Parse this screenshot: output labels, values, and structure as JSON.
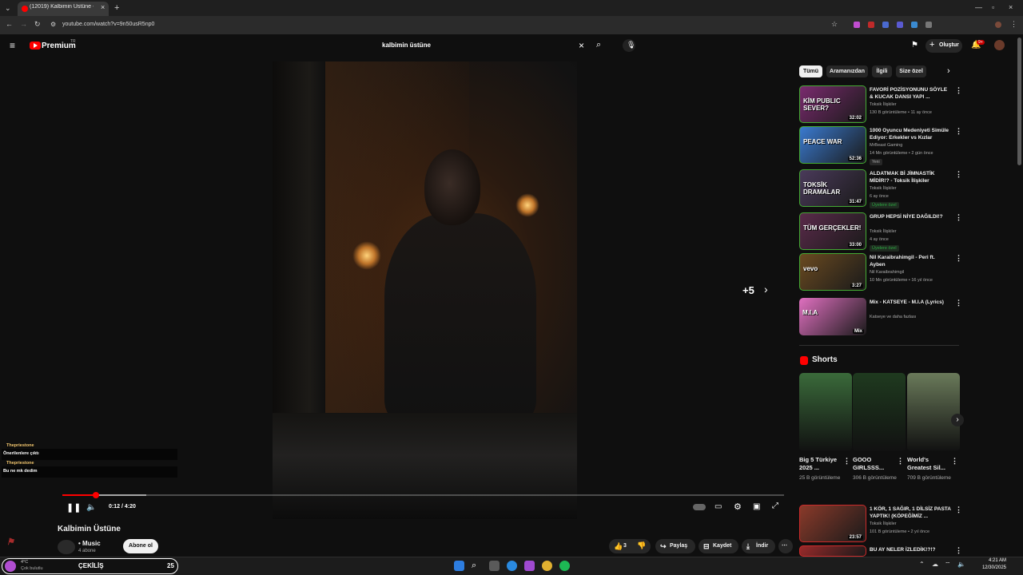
{
  "browser": {
    "tab_title": "(12019) Kalbimin Üstüne -",
    "url": "youtube.com/watch?v=9n50usR5np0"
  },
  "header": {
    "logo_text": "Premium",
    "region": "TR",
    "search_value": "kalbimin üstüne",
    "create_label": "Oluştur",
    "notif_count": "9+"
  },
  "player": {
    "time": "0:12 / 4:20",
    "progress_fraction": 0.0462,
    "more_count": "+5"
  },
  "chat": [
    {
      "name": "Thepriestone",
      "message": "Önerilenlere çıktı"
    },
    {
      "name": "Thepriestone",
      "message": "Bu ne mk dedim"
    }
  ],
  "video": {
    "title": "Kalbimin Üstüne",
    "channel": "• Music",
    "subscribers": "4 abone",
    "subscribe_label": "Abone ol",
    "likes": "3",
    "share_label": "Paylaş",
    "save_label": "Kaydet",
    "download_label": "İndir"
  },
  "chips": [
    "Tümü",
    "Aramanızdan",
    "İlgili",
    "Size özel"
  ],
  "related": [
    {
      "title": "FAVORİ POZİSYONUNU SÖYLE & KUCAK DANSI YAPI ...",
      "channel": "Toksik İlişkiler",
      "meta": "130 B görüntüleme • 11 ay önce",
      "duration": "32:02",
      "thumb_text": "KİM PUBLIC SEVER?",
      "color": "#7a2a6e"
    },
    {
      "title": "1000 Oyuncu Medeniyeti Simüle Ediyor: Erkekler vs Kızlar",
      "channel": "MrBeast Gaming",
      "meta": "14 Mn görüntüleme • 2 gün önce",
      "badge": "Yeni",
      "duration": "52:36",
      "thumb_text": "PEACE WAR",
      "color": "#3a7ad0"
    },
    {
      "title": "ALDATMAK Bİ JİMNASTİK MİDİR!? - Toksik İlişkiler",
      "channel": "Toksik İlişkiler",
      "meta": "6 ay önce",
      "member": "Üyelere özel",
      "duration": "31:47",
      "thumb_text": "TOKSİK DRAMALAR",
      "color": "#4a3a5a"
    },
    {
      "title": "GRUP HEPSİ NİYE DAĞILDI!?",
      "channel": "Toksik İlişkiler",
      "meta": "4 ay önce",
      "member": "Üyelere özel",
      "duration": "33:00",
      "thumb_text": "TÜM GERÇEKLER!",
      "color": "#5a2a4a"
    },
    {
      "title": "Nil Karaibrahimgil - Peri ft. Ayben",
      "channel": "Nil Karaibrahimgil",
      "meta": "10 Mn görüntüleme • 16 yıl önce",
      "duration": "3:27",
      "thumb_text": "vevo",
      "color": "#6a4a20"
    },
    {
      "title": "Mix - KATSEYE - M.I.A (Lyrics)",
      "channel": "Katseye ve daha fazlası",
      "meta": "",
      "duration": "Mix",
      "thumb_text": "M.I.A",
      "color": "#e070c0"
    }
  ],
  "shorts": {
    "heading": "Shorts",
    "items": [
      {
        "title": "Big 5 Türkiye 2025 ...",
        "views": "25 B görüntüleme",
        "color": "#3a6a3a"
      },
      {
        "title": "GOOO GIRLSSS...",
        "views": "306 B görüntüleme",
        "color": "#1f3a1f"
      },
      {
        "title": "World's Greatest Sil...",
        "views": "709 B görüntüleme",
        "color": "#6a7a5a"
      }
    ]
  },
  "related_after": [
    {
      "title": "1 KÖR, 1 SAĞIR, 1 DİLSİZ PASTA YAPTIK! (KÖPEĞİMİZ ...",
      "channel": "Toksik İlişkiler",
      "meta": "101 B görüntüleme • 2 yıl önce",
      "duration": "23:57",
      "color": "#8a3a2a"
    },
    {
      "title": "BU AY NELER İZLEDİK!?!?",
      "channel": "",
      "meta": "",
      "duration": "",
      "color": "#9a2a2a"
    }
  ],
  "taskbar": {
    "weather_temp": "4°C",
    "weather_desc": "Çok bulutlu",
    "giveaway_label": "ÇEKİLİŞ",
    "giveaway_count": "25",
    "time": "4:21 AM",
    "date": "12/30/2025"
  }
}
